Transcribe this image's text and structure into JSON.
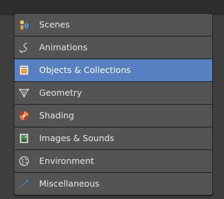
{
  "categories": {
    "items": [
      {
        "label": "Scenes",
        "icon": "scenes-icon"
      },
      {
        "label": "Animations",
        "icon": "animations-icon"
      },
      {
        "label": "Objects & Collections",
        "icon": "objects-collections-icon",
        "selected": true
      },
      {
        "label": "Geometry",
        "icon": "geometry-icon"
      },
      {
        "label": "Shading",
        "icon": "shading-icon"
      },
      {
        "label": "Images & Sounds",
        "icon": "images-sounds-icon"
      },
      {
        "label": "Environment",
        "icon": "environment-icon"
      },
      {
        "label": "Miscellaneous",
        "icon": "miscellaneous-icon"
      }
    ]
  },
  "colors": {
    "panel_background": "#3e3e3e",
    "item_background": "#545454",
    "selected_background": "#5680c2",
    "text": "#e6e6e6"
  }
}
